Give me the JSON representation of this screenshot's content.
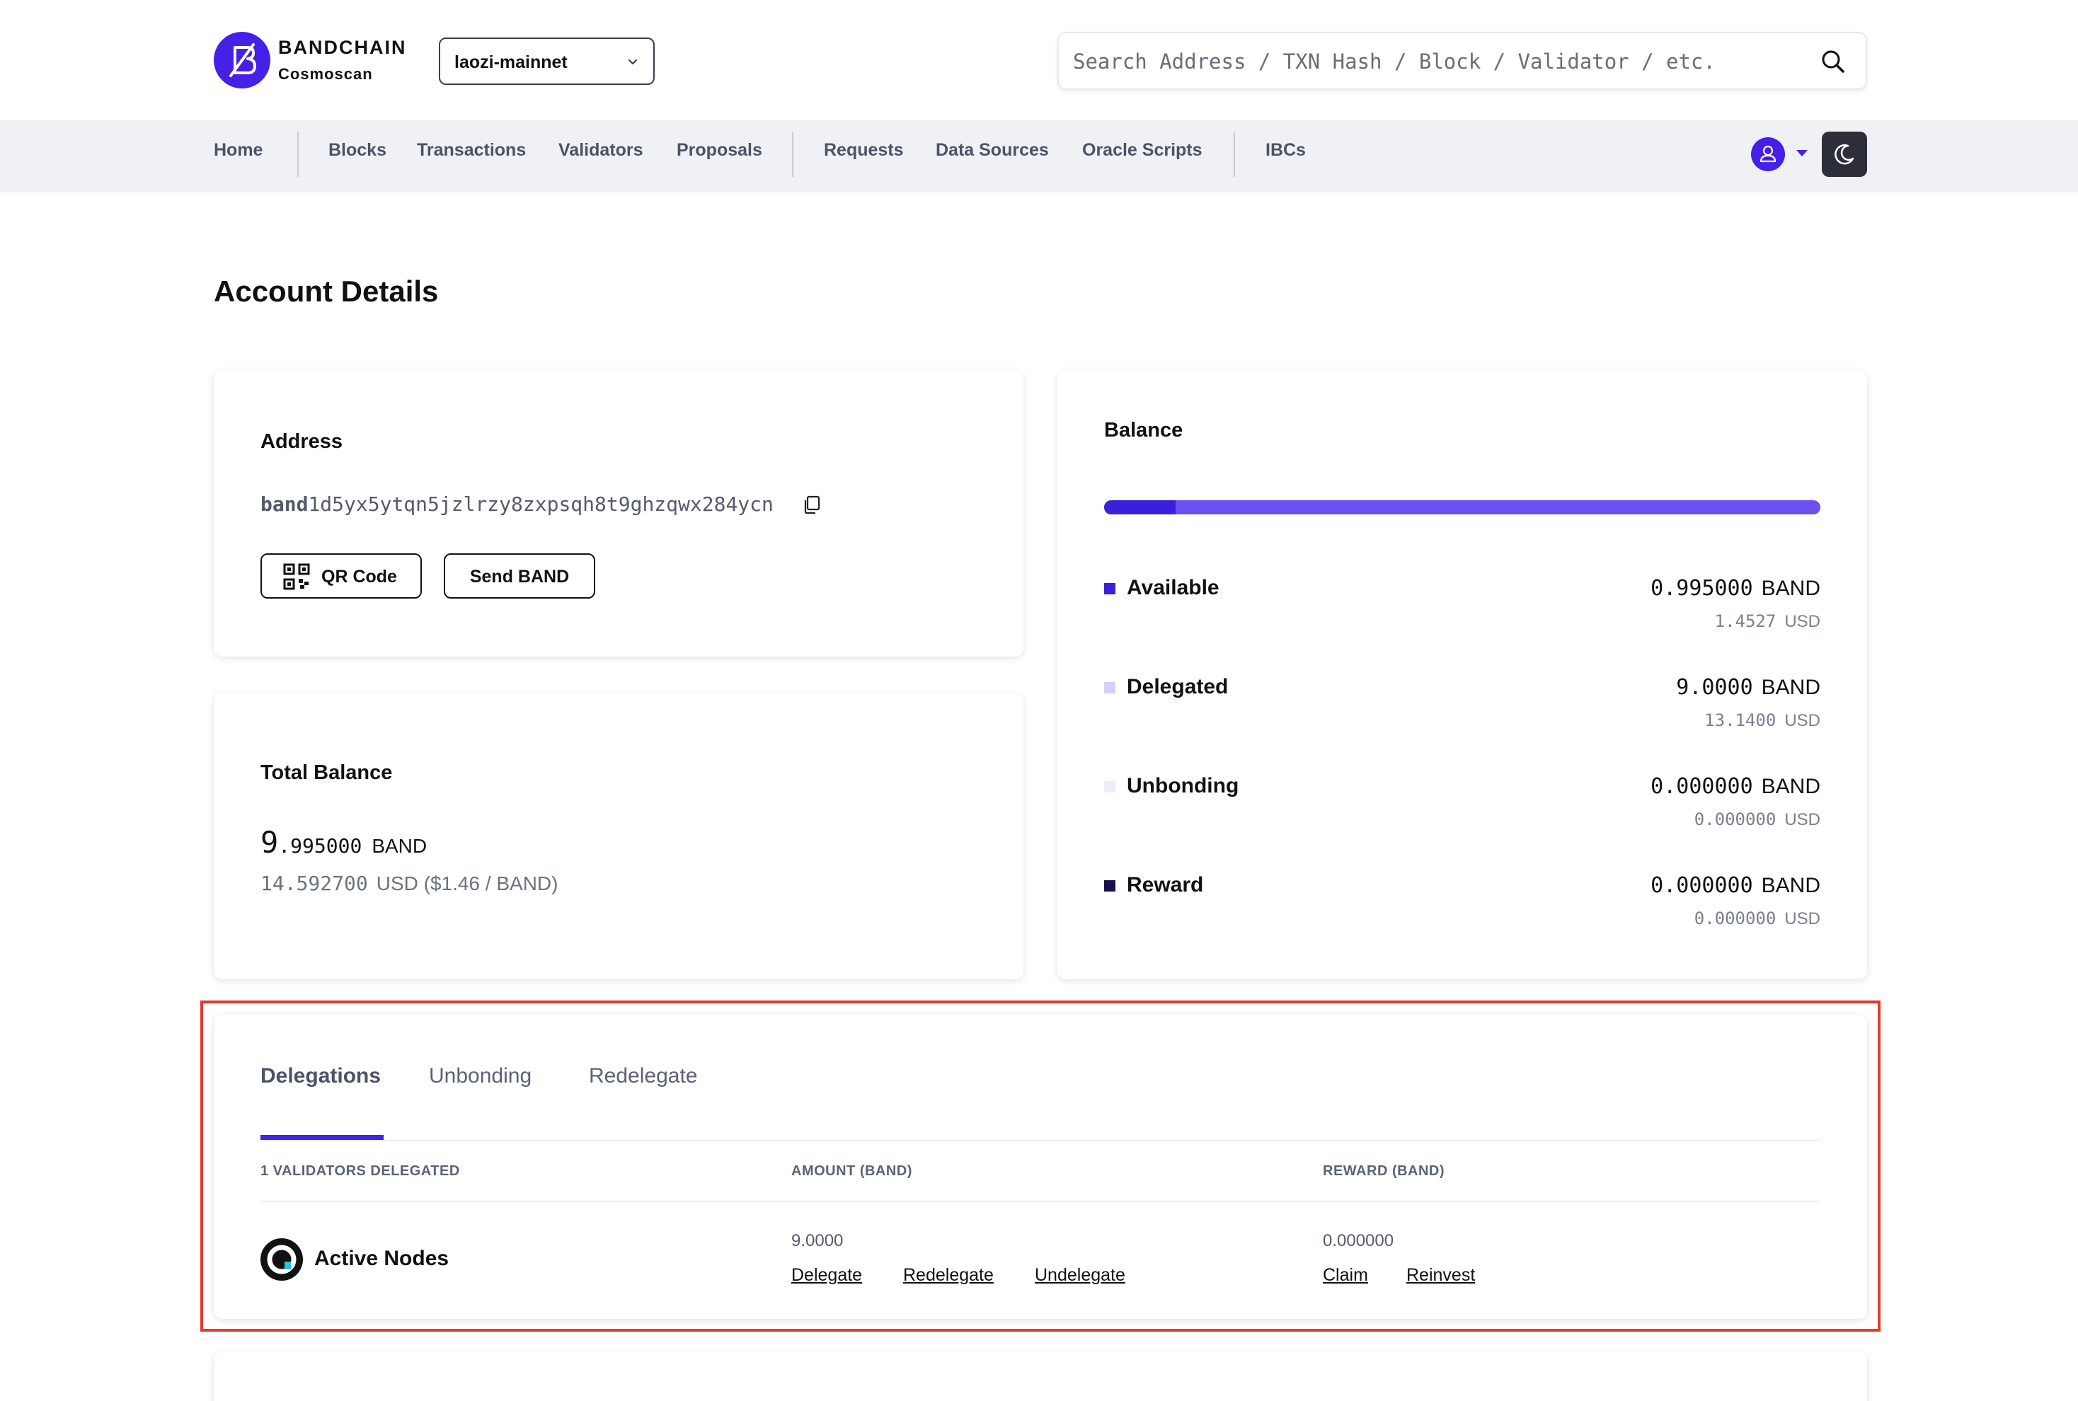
{
  "brand": {
    "name": "BANDCHAIN",
    "sub": "Cosmoscan"
  },
  "network": {
    "selected": "laozi-mainnet",
    "icon": "chevron-down-icon"
  },
  "search": {
    "placeholder": "Search Address / TXN Hash / Block / Validator / etc.",
    "value": ""
  },
  "nav": {
    "items": [
      "Home",
      "Blocks",
      "Transactions",
      "Validators",
      "Proposals",
      "Requests",
      "Data Sources",
      "Oracle Scripts",
      "IBCs"
    ],
    "icons": [
      "user-icon",
      "moon-icon"
    ]
  },
  "page": {
    "title": "Account Details"
  },
  "address": {
    "label": "Address",
    "prefix": "band",
    "rest": "1d5yx5ytqn5jzlrzy8zxpsqh8t9ghzqwx284ycn",
    "qr_label": "QR Code",
    "send_label": "Send BAND"
  },
  "total": {
    "label": "Total Balance",
    "int": "9",
    "dec": ".995000",
    "unit": "BAND",
    "usd": "14.592700",
    "usd_unit": "USD ($1.46 / BAND)"
  },
  "balance": {
    "label": "Balance",
    "bar_fraction": 0.0996,
    "rows": [
      {
        "name": "Available",
        "amount": "0.995000",
        "unit": "BAND",
        "usd": "1.4527",
        "usd_unit": "USD",
        "color": "#3a1fdc"
      },
      {
        "name": "Delegated",
        "amount": "9.0000",
        "unit": "BAND",
        "usd": "13.1400",
        "usd_unit": "USD",
        "color": "#d6cffa"
      },
      {
        "name": "Unbonding",
        "amount": "0.000000",
        "unit": "BAND",
        "usd": "0.000000",
        "usd_unit": "USD",
        "color": "#eeebfd"
      },
      {
        "name": "Reward",
        "amount": "0.000000",
        "unit": "BAND",
        "usd": "0.000000",
        "usd_unit": "USD",
        "color": "#16104f"
      }
    ]
  },
  "delegations": {
    "tabs": [
      "Delegations",
      "Unbonding",
      "Redelegate"
    ],
    "headers": [
      "1 VALIDATORS DELEGATED",
      "AMOUNT (BAND)",
      "REWARD (BAND)"
    ],
    "rows": [
      {
        "validator": "Active Nodes",
        "amount": "9.0000",
        "reward": "0.000000",
        "amount_actions": [
          "Delegate",
          "Redelegate",
          "Undelegate"
        ],
        "reward_actions": [
          "Claim",
          "Reinvest"
        ]
      }
    ]
  },
  "colors": {
    "accent": "#4520e6",
    "highlight": "#e8382b"
  }
}
